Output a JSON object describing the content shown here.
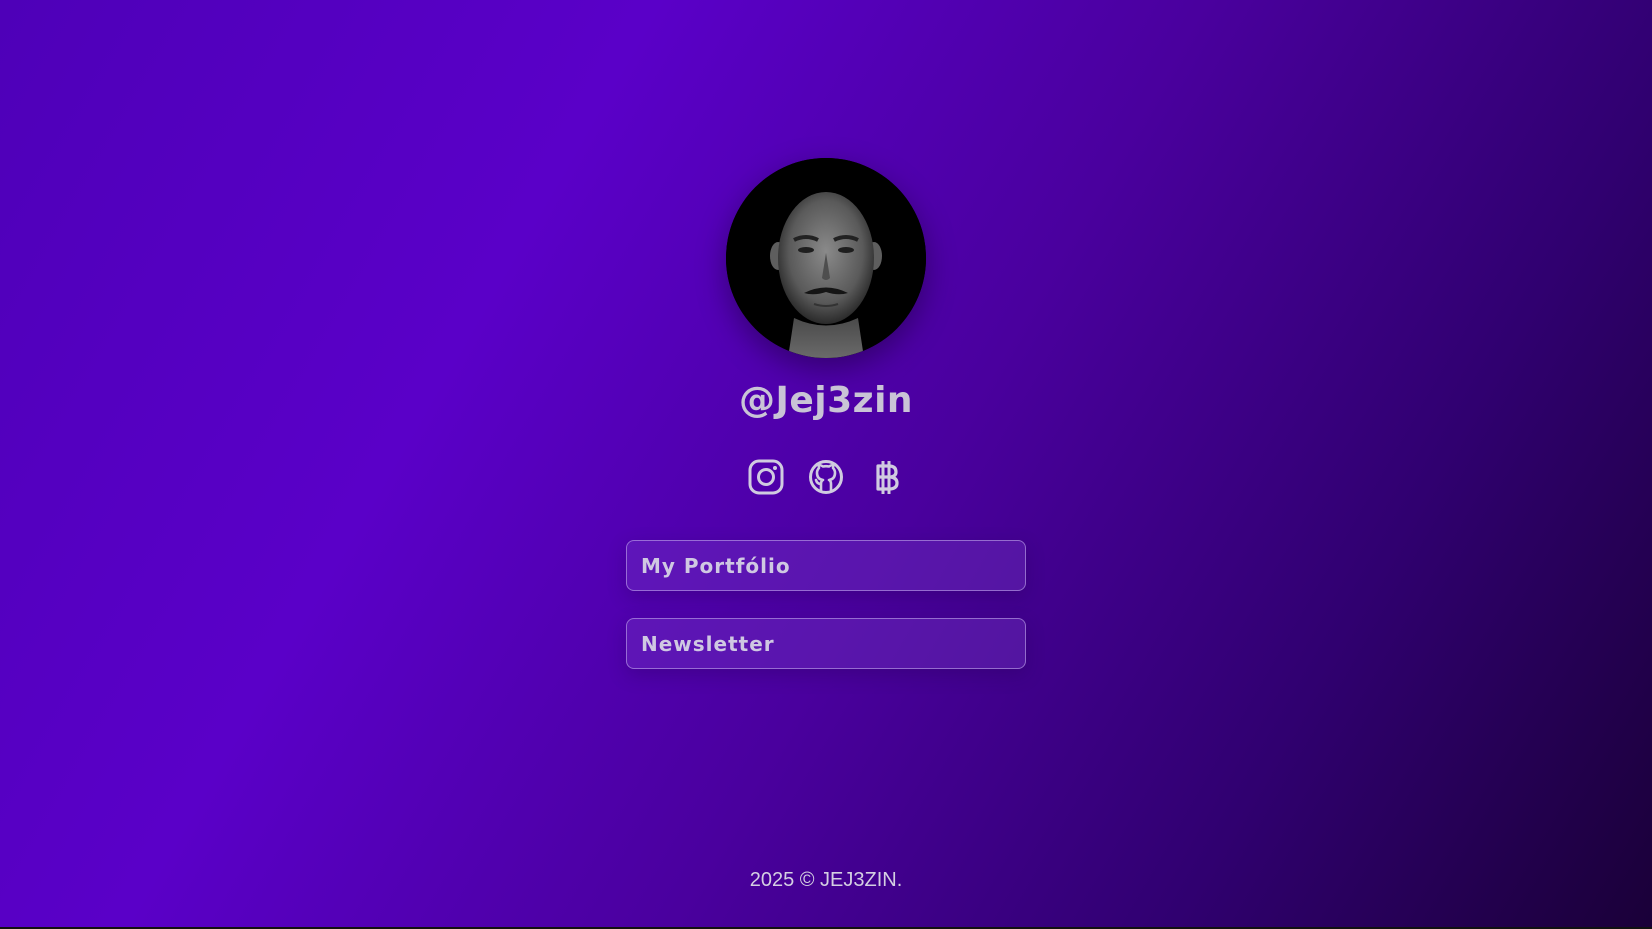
{
  "profile": {
    "handle": "@Jej3zin",
    "avatar_alt": "profile photo"
  },
  "socials": [
    {
      "name": "instagram",
      "icon": "instagram-icon"
    },
    {
      "name": "github",
      "icon": "github-icon"
    },
    {
      "name": "bitcoin",
      "icon": "baht-icon"
    }
  ],
  "links": {
    "portfolio_label": "My Portfólio",
    "newsletter_label": "Newsletter"
  },
  "footer": {
    "text": "2025 © JEJ3ZIN."
  },
  "colors": {
    "gradient_start": "#5a00c8",
    "gradient_end": "#1a0038",
    "text": "#c9c4d6"
  }
}
